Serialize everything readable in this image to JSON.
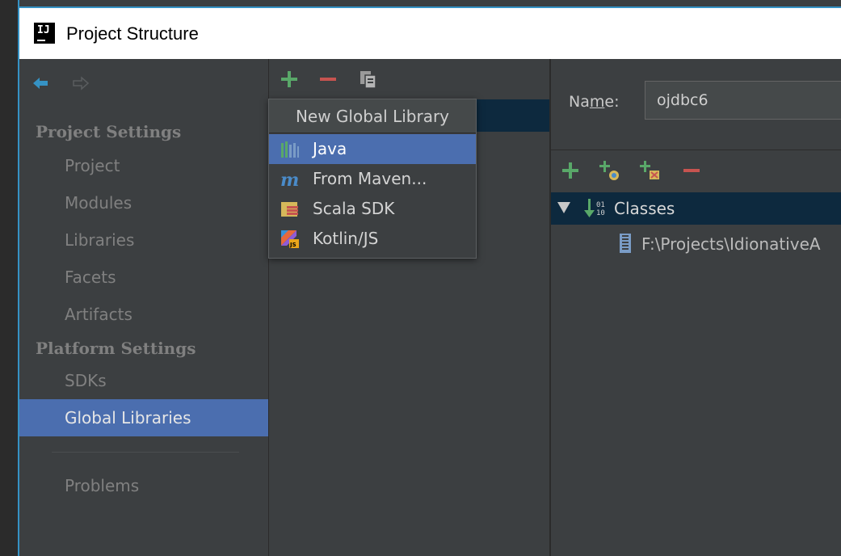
{
  "window": {
    "title": "Project Structure",
    "logo_text": "IJ"
  },
  "sidebar": {
    "project_settings_title": "Project Settings",
    "platform_settings_title": "Platform Settings",
    "items": [
      {
        "label": "Project"
      },
      {
        "label": "Modules"
      },
      {
        "label": "Libraries"
      },
      {
        "label": "Facets"
      },
      {
        "label": "Artifacts"
      },
      {
        "label": "SDKs"
      },
      {
        "label": "Global Libraries",
        "selected": true
      },
      {
        "label": "Problems"
      }
    ]
  },
  "popup": {
    "title": "New Global Library",
    "items": [
      {
        "label": "Java",
        "icon": "java-library-icon",
        "selected": true
      },
      {
        "label": "From Maven...",
        "icon": "maven-icon"
      },
      {
        "label": "Scala SDK",
        "icon": "scala-sdk-icon"
      },
      {
        "label": "Kotlin/JS",
        "icon": "kotlin-js-icon"
      }
    ]
  },
  "detail": {
    "name_label_pre": "Na",
    "name_label_mnemonic": "m",
    "name_label_post": "e:",
    "name_value": "ojdbc6",
    "tree_root_label": "Classes",
    "tree_child_label": "F:\\Projects\\IdionativeA"
  },
  "colors": {
    "accent": "#4b6eaf",
    "add_green": "#59a869",
    "remove_red": "#c75450",
    "nav_blue": "#3592c4"
  }
}
